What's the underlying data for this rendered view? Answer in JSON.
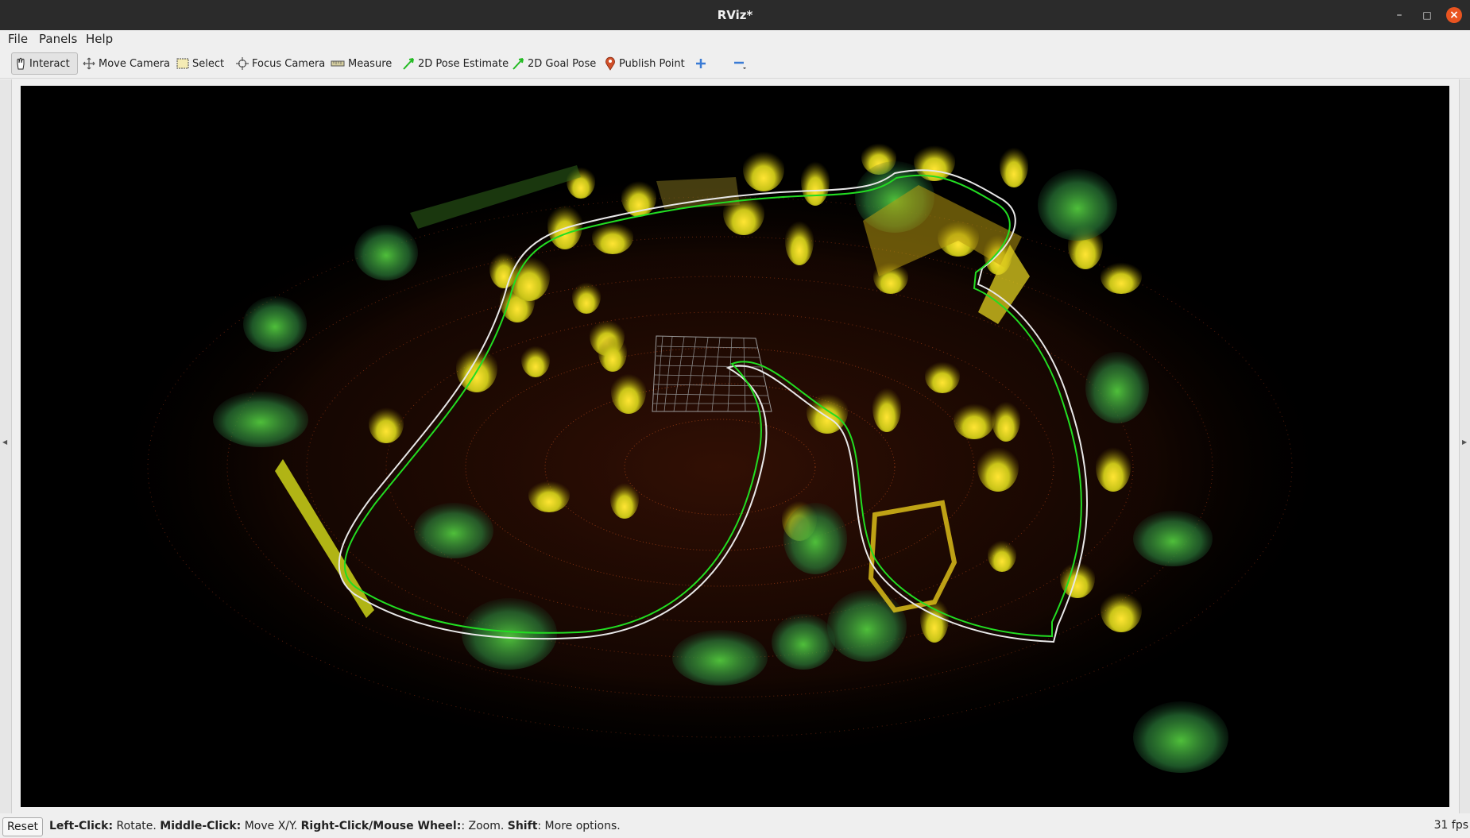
{
  "window": {
    "title": "RViz*"
  },
  "menu": {
    "file": "File",
    "panels": "Panels",
    "help": "Help"
  },
  "toolbar": {
    "interact": "Interact",
    "move_camera": "Move Camera",
    "select": "Select",
    "focus_camera": "Focus Camera",
    "measure": "Measure",
    "pose_estimate": "2D Pose Estimate",
    "goal_pose": "2D Goal Pose",
    "publish_point": "Publish Point",
    "add_tool_icon": "plus-icon",
    "remove_tool_icon": "minus-icon"
  },
  "status": {
    "reset": "Reset",
    "hint_left_key": "Left-Click:",
    "hint_left_val": " Rotate. ",
    "hint_middle_key": "Middle-Click:",
    "hint_middle_val": " Move X/Y. ",
    "hint_right_key": "Right-Click/Mouse Wheel:",
    "hint_right_val": ": Zoom. ",
    "hint_shift_key": "Shift",
    "hint_shift_val": ": More options.",
    "fps": "31 fps"
  },
  "colors": {
    "path_green": "#22dd22",
    "path_white": "#e8e8e8",
    "close_button": "#e95420",
    "viewport_bg": "#000000"
  }
}
